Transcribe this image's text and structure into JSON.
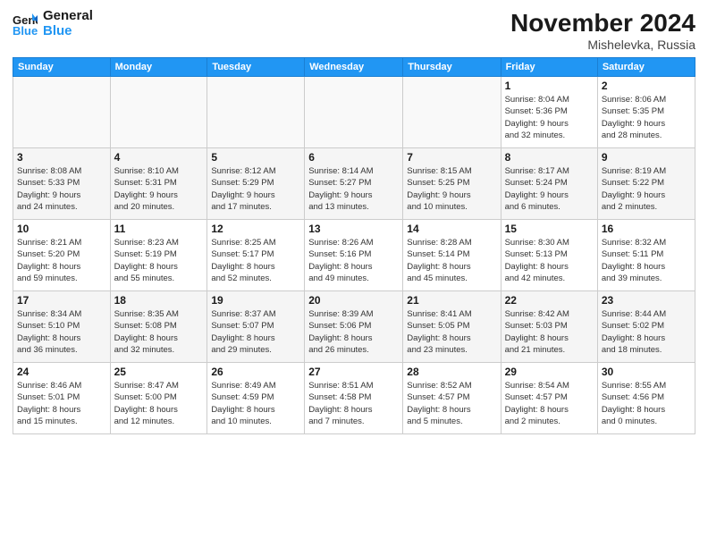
{
  "header": {
    "logo_line1": "General",
    "logo_line2": "Blue",
    "month_title": "November 2024",
    "subtitle": "Mishelevka, Russia"
  },
  "weekdays": [
    "Sunday",
    "Monday",
    "Tuesday",
    "Wednesday",
    "Thursday",
    "Friday",
    "Saturday"
  ],
  "weeks": [
    [
      {
        "day": "",
        "info": ""
      },
      {
        "day": "",
        "info": ""
      },
      {
        "day": "",
        "info": ""
      },
      {
        "day": "",
        "info": ""
      },
      {
        "day": "",
        "info": ""
      },
      {
        "day": "1",
        "info": "Sunrise: 8:04 AM\nSunset: 5:36 PM\nDaylight: 9 hours\nand 32 minutes."
      },
      {
        "day": "2",
        "info": "Sunrise: 8:06 AM\nSunset: 5:35 PM\nDaylight: 9 hours\nand 28 minutes."
      }
    ],
    [
      {
        "day": "3",
        "info": "Sunrise: 8:08 AM\nSunset: 5:33 PM\nDaylight: 9 hours\nand 24 minutes."
      },
      {
        "day": "4",
        "info": "Sunrise: 8:10 AM\nSunset: 5:31 PM\nDaylight: 9 hours\nand 20 minutes."
      },
      {
        "day": "5",
        "info": "Sunrise: 8:12 AM\nSunset: 5:29 PM\nDaylight: 9 hours\nand 17 minutes."
      },
      {
        "day": "6",
        "info": "Sunrise: 8:14 AM\nSunset: 5:27 PM\nDaylight: 9 hours\nand 13 minutes."
      },
      {
        "day": "7",
        "info": "Sunrise: 8:15 AM\nSunset: 5:25 PM\nDaylight: 9 hours\nand 10 minutes."
      },
      {
        "day": "8",
        "info": "Sunrise: 8:17 AM\nSunset: 5:24 PM\nDaylight: 9 hours\nand 6 minutes."
      },
      {
        "day": "9",
        "info": "Sunrise: 8:19 AM\nSunset: 5:22 PM\nDaylight: 9 hours\nand 2 minutes."
      }
    ],
    [
      {
        "day": "10",
        "info": "Sunrise: 8:21 AM\nSunset: 5:20 PM\nDaylight: 8 hours\nand 59 minutes."
      },
      {
        "day": "11",
        "info": "Sunrise: 8:23 AM\nSunset: 5:19 PM\nDaylight: 8 hours\nand 55 minutes."
      },
      {
        "day": "12",
        "info": "Sunrise: 8:25 AM\nSunset: 5:17 PM\nDaylight: 8 hours\nand 52 minutes."
      },
      {
        "day": "13",
        "info": "Sunrise: 8:26 AM\nSunset: 5:16 PM\nDaylight: 8 hours\nand 49 minutes."
      },
      {
        "day": "14",
        "info": "Sunrise: 8:28 AM\nSunset: 5:14 PM\nDaylight: 8 hours\nand 45 minutes."
      },
      {
        "day": "15",
        "info": "Sunrise: 8:30 AM\nSunset: 5:13 PM\nDaylight: 8 hours\nand 42 minutes."
      },
      {
        "day": "16",
        "info": "Sunrise: 8:32 AM\nSunset: 5:11 PM\nDaylight: 8 hours\nand 39 minutes."
      }
    ],
    [
      {
        "day": "17",
        "info": "Sunrise: 8:34 AM\nSunset: 5:10 PM\nDaylight: 8 hours\nand 36 minutes."
      },
      {
        "day": "18",
        "info": "Sunrise: 8:35 AM\nSunset: 5:08 PM\nDaylight: 8 hours\nand 32 minutes."
      },
      {
        "day": "19",
        "info": "Sunrise: 8:37 AM\nSunset: 5:07 PM\nDaylight: 8 hours\nand 29 minutes."
      },
      {
        "day": "20",
        "info": "Sunrise: 8:39 AM\nSunset: 5:06 PM\nDaylight: 8 hours\nand 26 minutes."
      },
      {
        "day": "21",
        "info": "Sunrise: 8:41 AM\nSunset: 5:05 PM\nDaylight: 8 hours\nand 23 minutes."
      },
      {
        "day": "22",
        "info": "Sunrise: 8:42 AM\nSunset: 5:03 PM\nDaylight: 8 hours\nand 21 minutes."
      },
      {
        "day": "23",
        "info": "Sunrise: 8:44 AM\nSunset: 5:02 PM\nDaylight: 8 hours\nand 18 minutes."
      }
    ],
    [
      {
        "day": "24",
        "info": "Sunrise: 8:46 AM\nSunset: 5:01 PM\nDaylight: 8 hours\nand 15 minutes."
      },
      {
        "day": "25",
        "info": "Sunrise: 8:47 AM\nSunset: 5:00 PM\nDaylight: 8 hours\nand 12 minutes."
      },
      {
        "day": "26",
        "info": "Sunrise: 8:49 AM\nSunset: 4:59 PM\nDaylight: 8 hours\nand 10 minutes."
      },
      {
        "day": "27",
        "info": "Sunrise: 8:51 AM\nSunset: 4:58 PM\nDaylight: 8 hours\nand 7 minutes."
      },
      {
        "day": "28",
        "info": "Sunrise: 8:52 AM\nSunset: 4:57 PM\nDaylight: 8 hours\nand 5 minutes."
      },
      {
        "day": "29",
        "info": "Sunrise: 8:54 AM\nSunset: 4:57 PM\nDaylight: 8 hours\nand 2 minutes."
      },
      {
        "day": "30",
        "info": "Sunrise: 8:55 AM\nSunset: 4:56 PM\nDaylight: 8 hours\nand 0 minutes."
      }
    ]
  ]
}
